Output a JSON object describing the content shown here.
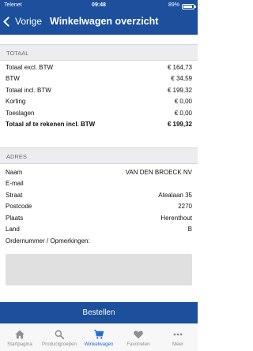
{
  "status": {
    "carrier": "Telenet",
    "time": "09:48",
    "battery": "89%"
  },
  "nav": {
    "back_label": "Vorige",
    "title": "Winkelwagen overzicht"
  },
  "totals": {
    "header": "TOTAAL",
    "rows": [
      {
        "label": "Totaal excl. BTW",
        "value": "€ 164,73"
      },
      {
        "label": "BTW",
        "value": "€ 34,59"
      },
      {
        "label": "Totaal incl. BTW",
        "value": "€ 199,32"
      },
      {
        "label": "Korting",
        "value": "€ 0,00"
      },
      {
        "label": "Toeslagen",
        "value": "€ 0,00"
      },
      {
        "label": "Totaal af te rekenen incl. BTW",
        "value": "€ 199,32"
      }
    ]
  },
  "address": {
    "header": "ADRES",
    "rows": [
      {
        "label": "Naam",
        "value": "VAN DEN BROECK NV"
      },
      {
        "label": "E-mail",
        "value": ""
      },
      {
        "label": "Straat",
        "value": "Atealaan 35"
      },
      {
        "label": "Postcode",
        "value": "2270"
      },
      {
        "label": "Plaats",
        "value": "Herenthout"
      },
      {
        "label": "Land",
        "value": "B"
      }
    ],
    "notes_label": "Ordernummer / Opmerkingen:",
    "notes_value": ""
  },
  "order_button": "Bestellen",
  "tabs": [
    {
      "label": "Startpagina",
      "icon": "home-icon"
    },
    {
      "label": "Productgroepen",
      "icon": "search-icon"
    },
    {
      "label": "Winkelwagen",
      "icon": "cart-icon"
    },
    {
      "label": "Favorieten",
      "icon": "heart-icon"
    },
    {
      "label": "Meer",
      "icon": "more-icon"
    }
  ],
  "colors": {
    "brand": "#1c4f9c",
    "tab_active": "#1c6bd1",
    "tab_inactive": "#8e8e93"
  }
}
